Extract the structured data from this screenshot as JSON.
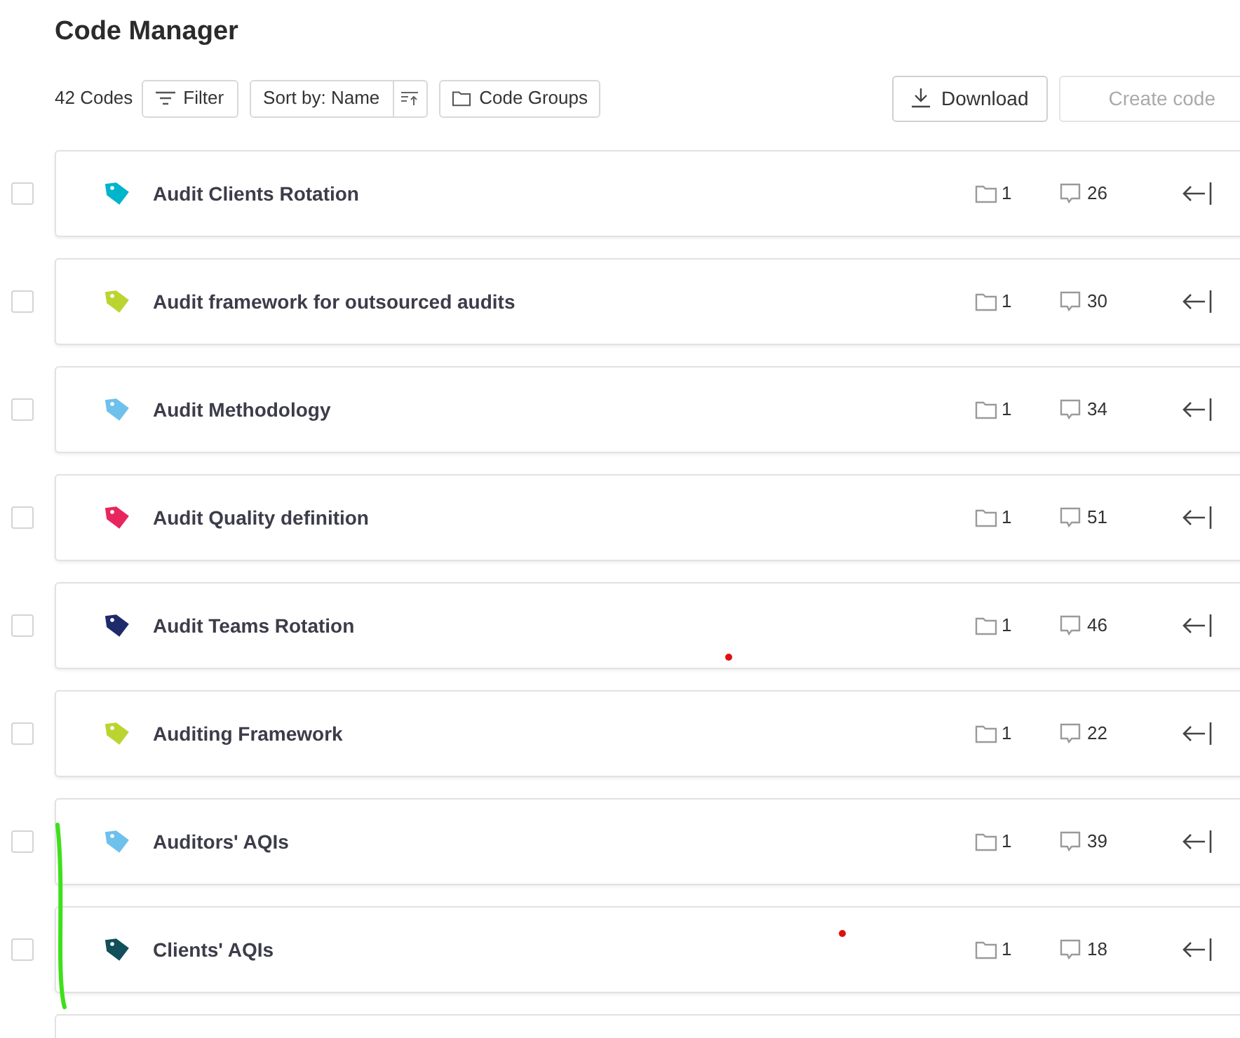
{
  "title": "Code Manager",
  "toolbar": {
    "count": "42 Codes",
    "filter": "Filter",
    "sort": "Sort by: Name",
    "groups": "Code Groups",
    "download": "Download",
    "create": "Create code"
  },
  "codes": [
    {
      "name": "Audit Clients Rotation",
      "color": "#00b4cc",
      "groups": "1",
      "comments": "26",
      "checked": false
    },
    {
      "name": "Audit framework for outsourced audits",
      "color": "#bcd431",
      "groups": "1",
      "comments": "30",
      "checked": false
    },
    {
      "name": "Audit Methodology",
      "color": "#6dc1ea",
      "groups": "1",
      "comments": "34",
      "checked": false
    },
    {
      "name": "Audit Quality definition",
      "color": "#e8255e",
      "groups": "1",
      "comments": "51",
      "checked": false
    },
    {
      "name": "Audit Teams Rotation",
      "color": "#1f2a6b",
      "groups": "1",
      "comments": "46",
      "checked": false
    },
    {
      "name": "Auditing Framework",
      "color": "#bcd431",
      "groups": "1",
      "comments": "22",
      "checked": false
    },
    {
      "name": "Auditors' AQIs",
      "color": "#6dc1ea",
      "groups": "1",
      "comments": "39",
      "checked": false
    },
    {
      "name": "Clients' AQIs",
      "color": "#114f5a",
      "groups": "1",
      "comments": "18",
      "checked": false
    }
  ]
}
